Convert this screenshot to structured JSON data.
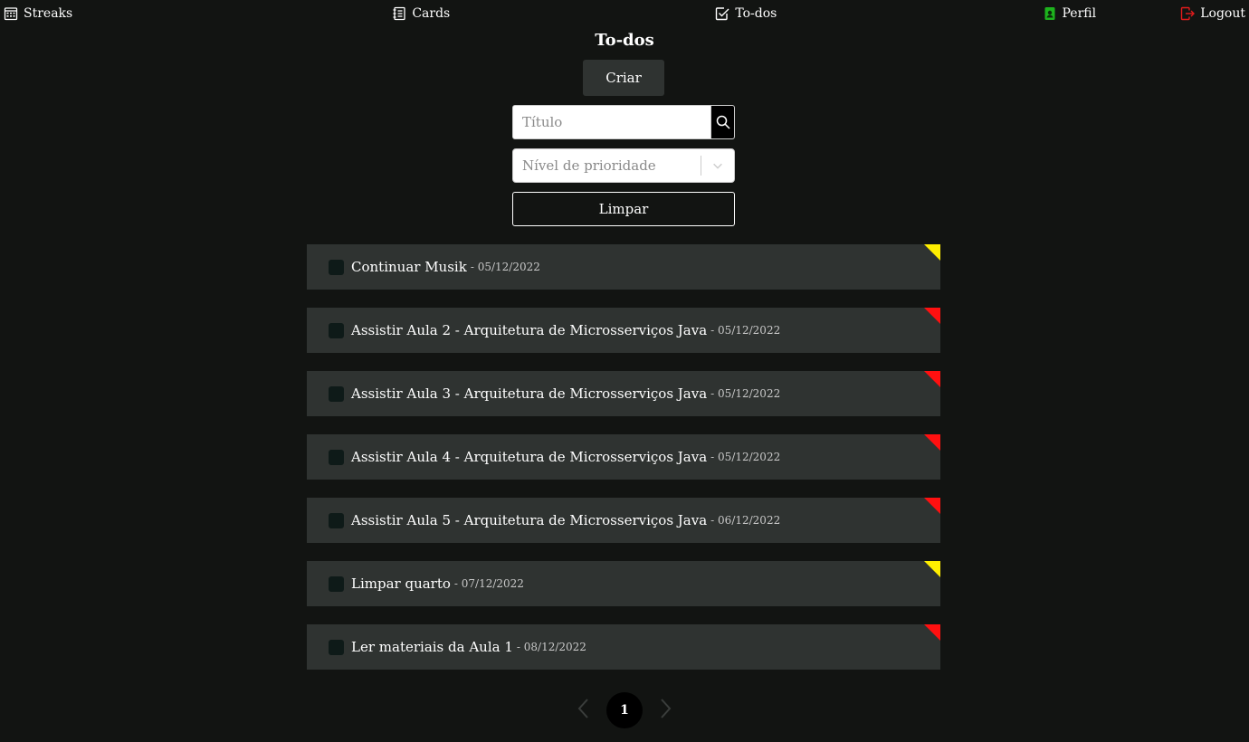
{
  "nav": {
    "streaks": "Streaks",
    "cards": "Cards",
    "todos": "To-dos",
    "profile": "Perfil",
    "logout": "Logout"
  },
  "header": {
    "title": "To-dos",
    "create_label": "Criar"
  },
  "filters": {
    "search_placeholder": "Título",
    "priority_placeholder": "Nível de prioridade",
    "clear_label": "Limpar"
  },
  "todos": [
    {
      "title": "Continuar Musik",
      "date": "05/12/2022",
      "priority": "medium"
    },
    {
      "title": "Assistir Aula 2 - Arquitetura de Microsserviços Java",
      "date": "05/12/2022",
      "priority": "high"
    },
    {
      "title": "Assistir Aula 3 - Arquitetura de Microsserviços Java",
      "date": "05/12/2022",
      "priority": "high"
    },
    {
      "title": "Assistir Aula 4 - Arquitetura de Microsserviços Java",
      "date": "05/12/2022",
      "priority": "high"
    },
    {
      "title": "Assistir Aula 5 - Arquitetura de Microsserviços Java",
      "date": "06/12/2022",
      "priority": "high"
    },
    {
      "title": "Limpar quarto",
      "date": "07/12/2022",
      "priority": "medium"
    },
    {
      "title": "Ler materiais da Aula 1",
      "date": "08/12/2022",
      "priority": "high"
    }
  ],
  "pagination": {
    "current_page": "1"
  },
  "colors": {
    "background": "#121412",
    "item_bg": "#2f3331",
    "priority_high": "#ff1010",
    "priority_medium": "#ffee00",
    "profile_icon": "#1db31d",
    "logout_icon": "#e31b1b"
  }
}
